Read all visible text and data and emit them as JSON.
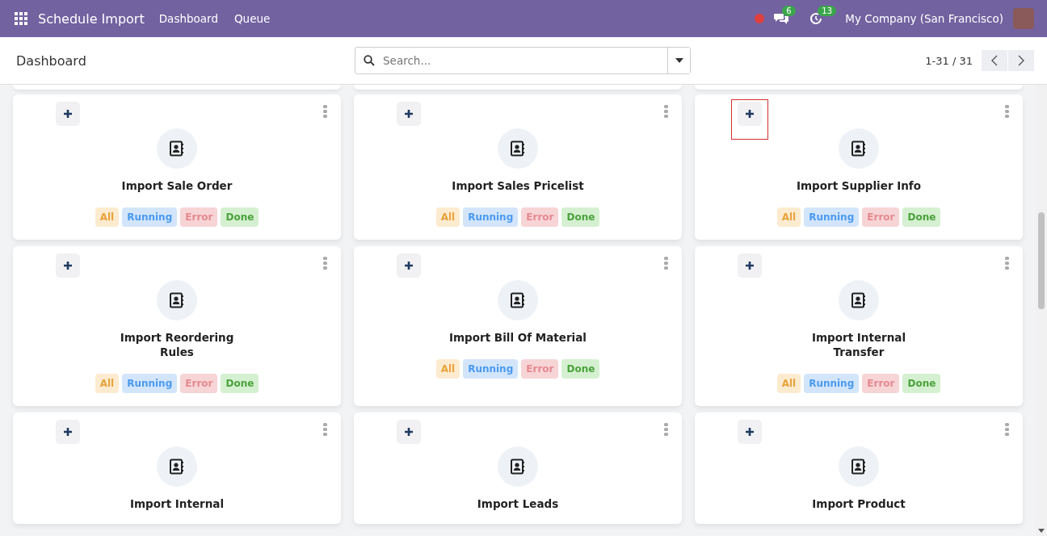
{
  "navbar": {
    "app_title": "Schedule Import",
    "menu": [
      "Dashboard",
      "Queue"
    ],
    "messages_badge": "6",
    "activities_badge": "13",
    "company": "My Company (San Francisco)"
  },
  "control_panel": {
    "breadcrumb": "Dashboard",
    "search": {
      "placeholder": "Search..."
    },
    "pager": "1-31 / 31"
  },
  "cards": [
    {
      "title": "Import Sale Order",
      "add_highlighted": false,
      "tags": [
        {
          "label": "All",
          "kind": "all"
        },
        {
          "label": "Running",
          "kind": "running"
        },
        {
          "label": "Error",
          "kind": "error"
        },
        {
          "label": "Done",
          "kind": "done"
        }
      ]
    },
    {
      "title": "Import Sales Pricelist",
      "add_highlighted": false,
      "tags": [
        {
          "label": "All",
          "kind": "all"
        },
        {
          "label": "Running",
          "kind": "running"
        },
        {
          "label": "Error",
          "kind": "error"
        },
        {
          "label": "Done",
          "kind": "done"
        }
      ]
    },
    {
      "title": "Import Supplier Info",
      "add_highlighted": true,
      "tags": [
        {
          "label": "All",
          "kind": "all"
        },
        {
          "label": "Running",
          "kind": "running"
        },
        {
          "label": "Error",
          "kind": "error"
        },
        {
          "label": "Done",
          "kind": "done"
        }
      ]
    },
    {
      "title": "Import Reordering Rules",
      "add_highlighted": false,
      "tags": [
        {
          "label": "All",
          "kind": "all"
        },
        {
          "label": "Running",
          "kind": "running"
        },
        {
          "label": "Error",
          "kind": "error"
        },
        {
          "label": "Done",
          "kind": "done"
        }
      ]
    },
    {
      "title": "Import Bill Of Material",
      "add_highlighted": false,
      "tags": [
        {
          "label": "All",
          "kind": "all"
        },
        {
          "label": "Running",
          "kind": "running"
        },
        {
          "label": "Error",
          "kind": "error"
        },
        {
          "label": "Done",
          "kind": "done"
        }
      ]
    },
    {
      "title": "Import Internal Transfer",
      "add_highlighted": false,
      "tags": [
        {
          "label": "All",
          "kind": "all"
        },
        {
          "label": "Running",
          "kind": "running"
        },
        {
          "label": "Error",
          "kind": "error"
        },
        {
          "label": "Done",
          "kind": "done"
        }
      ]
    },
    {
      "title": "Import Internal",
      "add_highlighted": false
    },
    {
      "title": "Import Leads",
      "add_highlighted": false
    },
    {
      "title": "Import Product",
      "add_highlighted": false
    }
  ]
}
